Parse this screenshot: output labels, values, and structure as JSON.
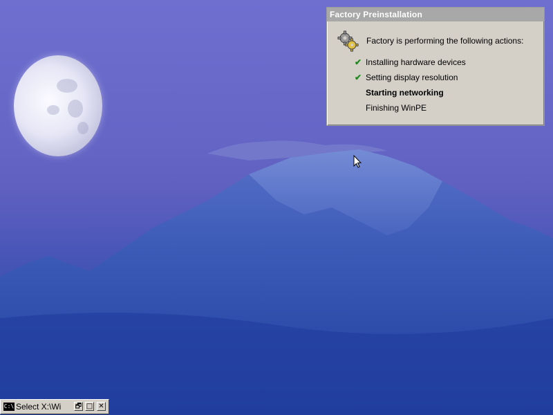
{
  "dialog": {
    "title": "Factory Preinstallation",
    "intro": "Factory is performing the following actions:",
    "steps": [
      {
        "label": "Installing hardware devices",
        "status": "done",
        "icon": "check-icon"
      },
      {
        "label": "Setting display resolution",
        "status": "done",
        "icon": "check-icon"
      },
      {
        "label": "Starting networking",
        "status": "in-progress",
        "icon": ""
      },
      {
        "label": "Finishing WinPE",
        "status": "pending",
        "icon": ""
      }
    ],
    "check_glyph": "✔",
    "check_color": "#1a8a1a",
    "header_icon": "gears-icon"
  },
  "taskbar": {
    "window_icon_text": "C:\\",
    "window_label": "Select X:\\Wi",
    "minimize_glyph": "🗗",
    "maximize_glyph": "□",
    "close_glyph": "✕"
  },
  "wallpaper": {
    "description_icons": [
      "moon",
      "mountain"
    ],
    "sky_color": "#6b6bcc",
    "mountain_color": "#2f4aa8"
  }
}
